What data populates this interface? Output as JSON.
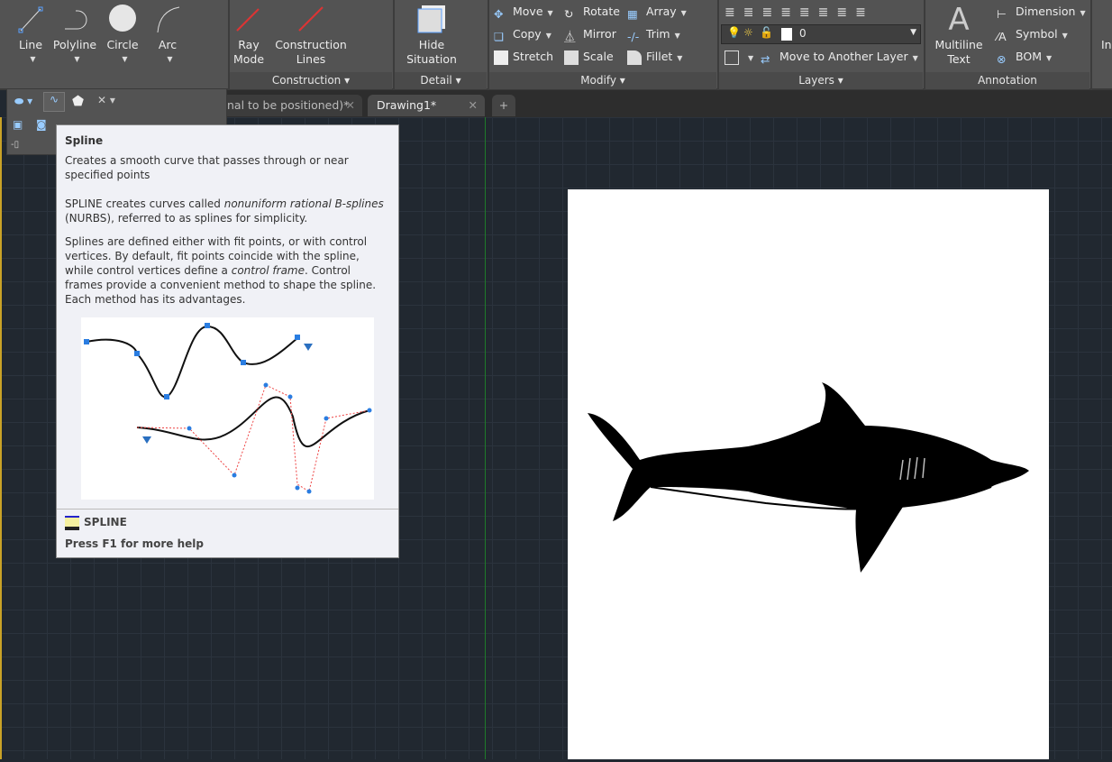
{
  "ribbon": {
    "draw": {
      "line": "Line",
      "polyline": "Polyline",
      "circle": "Circle",
      "arc": "Arc"
    },
    "construction": {
      "ray_mode": [
        "Ray",
        "Mode"
      ],
      "construction_lines": [
        "Construction",
        "Lines"
      ],
      "title": "Construction"
    },
    "detail": {
      "hide_situation": [
        "Hide",
        "Situation"
      ],
      "title": "Detail"
    },
    "modify": {
      "move": "Move",
      "rotate": "Rotate",
      "array": "Array",
      "copy": "Copy",
      "mirror": "Mirror",
      "trim": "Trim",
      "stretch": "Stretch",
      "scale": "Scale",
      "fillet": "Fillet",
      "title": "Modify"
    },
    "layers": {
      "current_layer": "0",
      "move_to_another_layer": "Move to Another Layer",
      "title": "Layers"
    },
    "annotation": {
      "multiline_text": [
        "Multiline",
        "Text"
      ],
      "dimension": "Dimension",
      "symbol": "Symbol",
      "bom": "BOM",
      "title": "Annotation"
    },
    "cut_label": "In"
  },
  "tabs": [
    {
      "label": "nal to be positioned)*"
    },
    {
      "label": "Drawing1*",
      "active": true
    }
  ],
  "tooltip": {
    "title": "Spline",
    "summary": "Creates a smooth curve that passes through or near specified points",
    "p1": [
      "SPLINE creates curves called ",
      "nonuniform rational B-splines",
      " (NURBS), referred to as splines for simplicity."
    ],
    "p2": [
      "Splines are defined either with fit points, or with control vertices. By default, fit points coincide with the spline, while control vertices define a ",
      "control frame",
      ". Control frames provide a convenient method to shape the spline. Each method has its advantages."
    ],
    "command": "SPLINE",
    "help": "Press F1 for more help"
  },
  "colors": {
    "ribbon": "#535353",
    "canvas": "#212830",
    "tooltip": "#f0f1f6",
    "accent": "#3b8fd9"
  }
}
